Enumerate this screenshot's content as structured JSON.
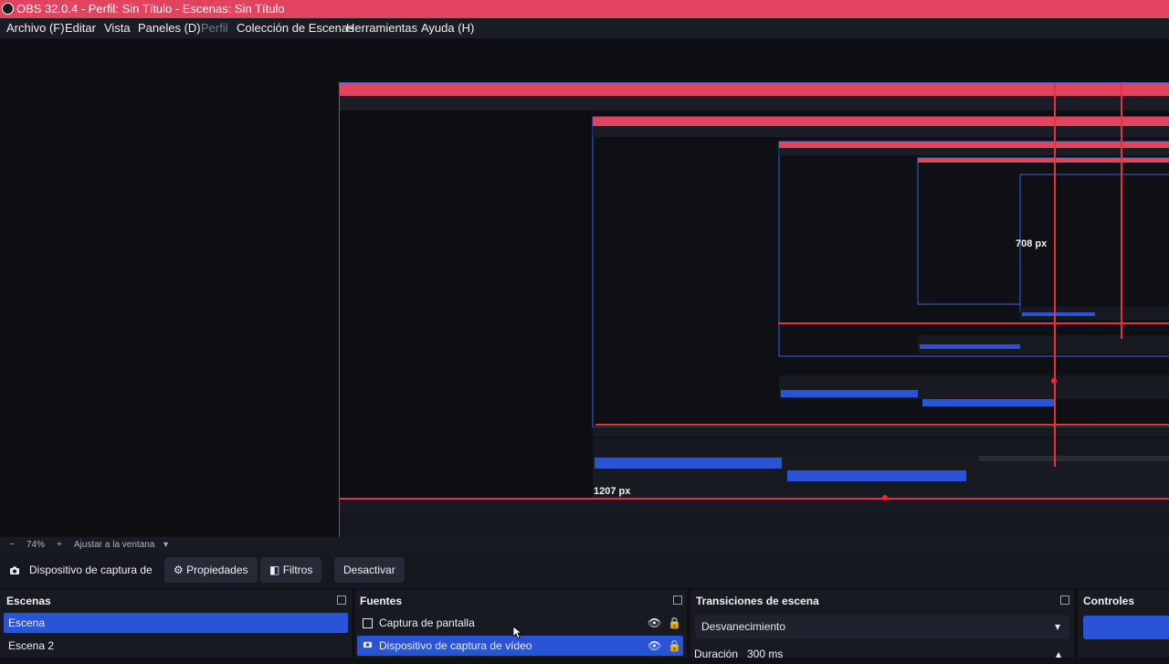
{
  "window": {
    "title": "OBS 32.0.4 - Perfil: Sin Título - Escenas: Sin Título"
  },
  "menu": {
    "items": [
      {
        "label": "Archivo (F)",
        "enabled": true
      },
      {
        "label": "Editar",
        "enabled": true
      },
      {
        "label": "Vista",
        "enabled": true
      },
      {
        "label": "Paneles (D)",
        "enabled": true
      },
      {
        "label": "Perfil",
        "enabled": false
      },
      {
        "label": "Colección de Escenas",
        "enabled": true
      },
      {
        "label": "Herramientas",
        "enabled": true
      },
      {
        "label": "Ayuda (H)",
        "enabled": true
      }
    ]
  },
  "preview": {
    "measure_labels": [
      "1207 px",
      "708 px"
    ]
  },
  "zoom": {
    "minus": "−",
    "value": "74%",
    "plus": "+",
    "fit_label": "Ajustar a la ventana"
  },
  "source_toolbar": {
    "source_name": "Dispositivo de captura de v",
    "properties_label": "Propiedades",
    "filters_label": "Filtros",
    "deactivate_label": "Desactivar"
  },
  "docks": {
    "scenes": {
      "title": "Escenas",
      "items": [
        {
          "label": "Escena",
          "selected": true
        },
        {
          "label": "Escena 2",
          "selected": false
        }
      ]
    },
    "sources": {
      "title": "Fuentes",
      "items": [
        {
          "label": "Captura de pantalla",
          "icon": "monitor-icon",
          "selected": false
        },
        {
          "label": "Dispositivo de captura de vídeo",
          "icon": "camera-icon",
          "selected": true
        }
      ]
    },
    "transitions": {
      "title": "Transiciones de escena",
      "transition": "Desvanecimiento",
      "duration_label": "Duración",
      "duration_value": "300 ms"
    },
    "controls": {
      "title": "Controles"
    }
  },
  "colors": {
    "accent": "#2a54d6",
    "titlebar": "#e2435e",
    "measure": "#e8303f"
  }
}
